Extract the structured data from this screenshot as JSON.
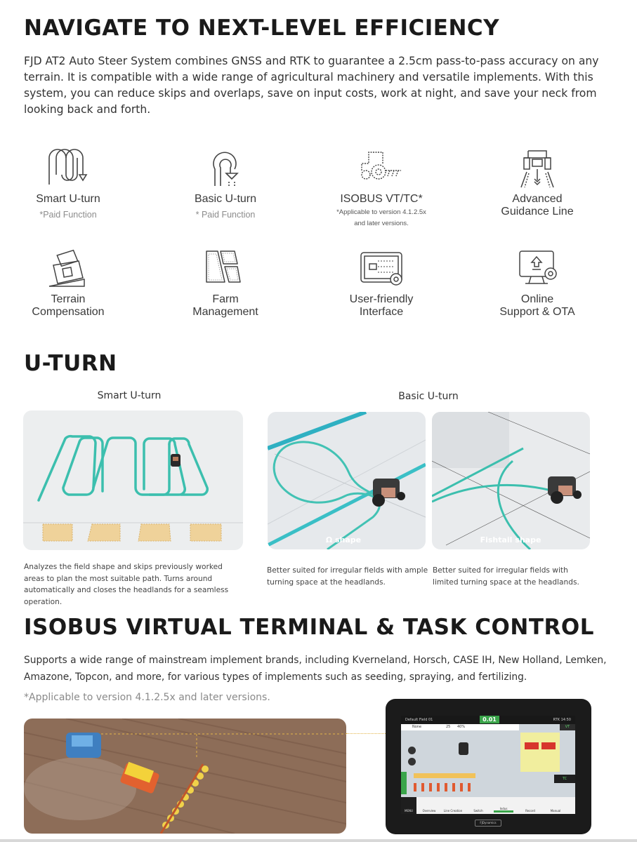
{
  "section1": {
    "title": "NAVIGATE TO NEXT-LEVEL EFFICIENCY",
    "intro": "FJD AT2 Auto Steer System combines GNSS and RTK to guarantee a 2.5cm pass-to-pass accuracy on any terrain. It is compatible with a wide range of agricultural machinery and versatile implements. With this system, you can reduce skips and overlaps, save on input costs, work at night, and save your neck from looking back and forth.",
    "features": [
      {
        "icon": "smart-u-turn-icon",
        "label": "Smart U-turn",
        "note": "*Paid Function"
      },
      {
        "icon": "basic-u-turn-icon",
        "label": "Basic U-turn",
        "note": "* Paid Function"
      },
      {
        "icon": "tractor-implement-icon",
        "label": "ISOBUS VT/TC*",
        "note_line1": "*Applicable to version 4.1.2.5x",
        "note_line2": "and later versions."
      },
      {
        "icon": "guidance-line-icon",
        "label_line1": "Advanced",
        "label_line2": "Guidance Line"
      },
      {
        "icon": "terrain-compensation-icon",
        "label_line1": "Terrain",
        "label_line2": "Compensation"
      },
      {
        "icon": "farm-fields-icon",
        "label_line1": "Farm",
        "label_line2": "Management"
      },
      {
        "icon": "interface-settings-icon",
        "label_line1": "User-friendly",
        "label_line2": "Interface"
      },
      {
        "icon": "monitor-update-icon",
        "label_line1": "Online",
        "label_line2": "Support & OTA"
      }
    ]
  },
  "section2": {
    "title": "U-TURN",
    "smart_label": "Smart U-turn",
    "basic_label": "Basic U-turn",
    "omega_caption": "Ω shape",
    "fishtail_caption": "Fishtail shape",
    "smart_desc": "Analyzes the field shape and skips previously worked areas to plan the most suitable path. Turns around automatically and closes the headlands for a seamless operation.",
    "omega_desc": "Better suited for irregular fields with ample turning space at the headlands.",
    "fishtail_desc": "Better suited for irregular fields with limited turning space at the headlands."
  },
  "section3": {
    "title": "ISOBUS VIRTUAL TERMINAL & TASK CONTROL",
    "desc": "Supports a wide range of mainstream implement brands, including Kverneland, Horsch, CASE IH, New Holland, Lemken, Amazone, Topcon, and more, for various types of implements such as seeding, spraying, and fertilizing.",
    "note": "*Applicable to version 4.1.2.5x and later versions.",
    "tablet": {
      "field_name": "Default Field 01",
      "speed": "0.01",
      "status": "RTK 14:50",
      "info_none": "None",
      "info_width": "25",
      "info_percent": "40%",
      "vt_badge": "VT",
      "tc_badge": "TC",
      "menu_items": [
        "MENU",
        "Overview",
        "Line Creation",
        "Switch",
        "Indus",
        "Record",
        "Manual"
      ],
      "brand": "FJDynamics"
    }
  },
  "colors": {
    "path_teal": "#3cbfae",
    "field_bg": "#eef0f0",
    "headline": "#1a1a1a",
    "note_gray": "#8c8c8c",
    "accent_green": "#3aa54a",
    "soil": "#8d6d58"
  }
}
